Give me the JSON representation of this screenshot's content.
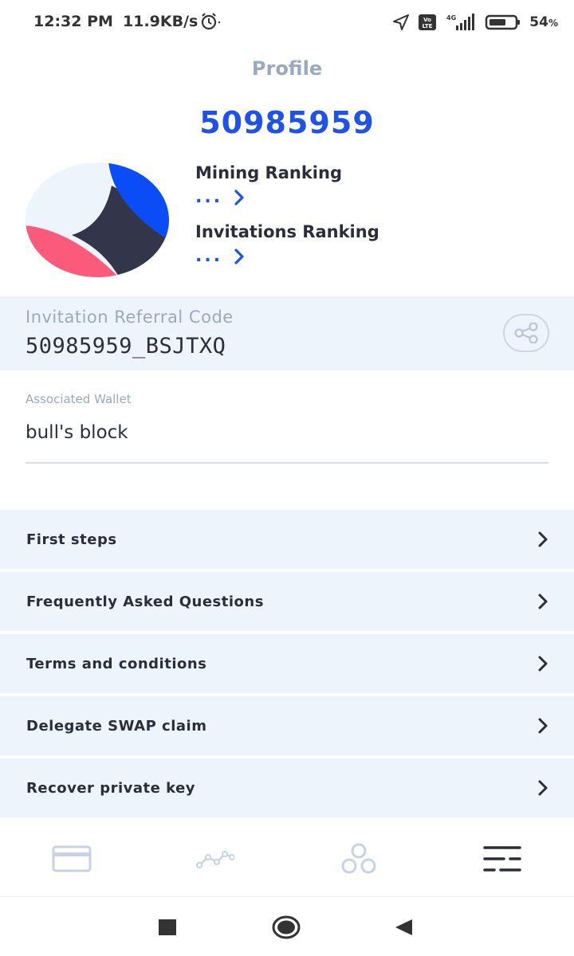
{
  "status_bar": {
    "time": "12:32 PM",
    "speed": "11.9KB/s",
    "network": "4G",
    "volte": "Vo LTE",
    "battery": "54",
    "battery_unit": "%"
  },
  "header": {
    "title": "Profile",
    "user_id": "50985959"
  },
  "rankings": {
    "mining_label": "Mining Ranking",
    "mining_value": "...",
    "invitations_label": "Invitations Ranking",
    "invitations_value": "..."
  },
  "referral": {
    "label": "Invitation Referral Code",
    "code": "50985959_BSJTXQ"
  },
  "wallet": {
    "label": "Associated Wallet",
    "value": "bull's block"
  },
  "menu": {
    "items": [
      {
        "label": "First steps"
      },
      {
        "label": "Frequently Asked Questions"
      },
      {
        "label": "Terms and conditions"
      },
      {
        "label": "Delegate SWAP claim"
      },
      {
        "label": "Recover private key"
      }
    ]
  },
  "tabs": [
    "wallet-icon",
    "chart-icon",
    "community-icon",
    "menu-icon"
  ],
  "colors": {
    "accent": "#1f52e6",
    "muted": "#9aa9be",
    "panel": "#eef4fc",
    "dark": "#2b2d3c",
    "pink": "#fb5a7a"
  }
}
